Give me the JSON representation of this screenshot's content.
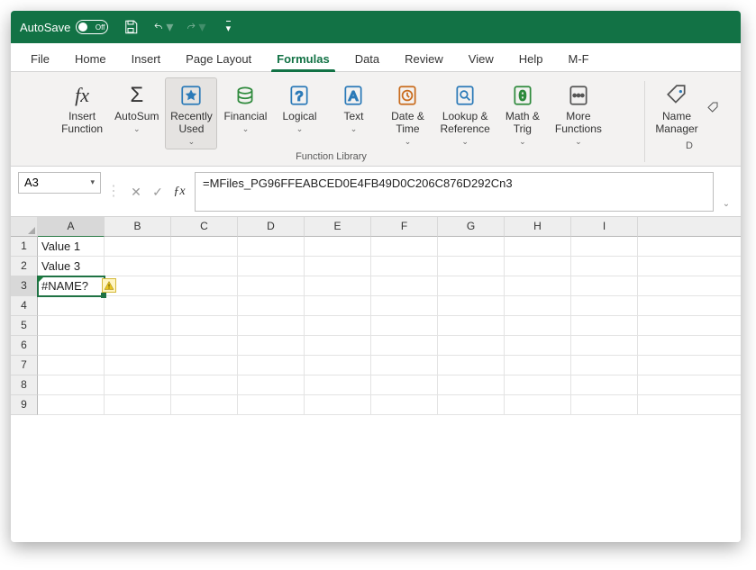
{
  "titlebar": {
    "autosave_label": "AutoSave",
    "autosave_state": "Off"
  },
  "tabs": {
    "items": [
      {
        "label": "File"
      },
      {
        "label": "Home"
      },
      {
        "label": "Insert"
      },
      {
        "label": "Page Layout"
      },
      {
        "label": "Formulas",
        "active": true
      },
      {
        "label": "Data"
      },
      {
        "label": "Review"
      },
      {
        "label": "View"
      },
      {
        "label": "Help"
      },
      {
        "label": "M-F"
      }
    ]
  },
  "ribbon": {
    "function_library_label": "Function Library",
    "defined_names_label": "D",
    "buttons": {
      "insert_function": "Insert\nFunction",
      "autosum": "AutoSum",
      "recently_used": "Recently\nUsed",
      "financial": "Financial",
      "logical": "Logical",
      "text": "Text",
      "date_time": "Date &\nTime",
      "lookup_ref": "Lookup &\nReference",
      "math_trig": "Math &\nTrig",
      "more_functions": "More\nFunctions",
      "name_manager": "Name\nManager"
    }
  },
  "formula_bar": {
    "name_box": "A3",
    "formula": "=MFiles_PG96FFEABCED0E4FB49D0C206C876D292Cn3"
  },
  "sheet": {
    "columns": [
      "A",
      "B",
      "C",
      "D",
      "E",
      "F",
      "G",
      "H",
      "I"
    ],
    "row_count": 9,
    "selected_cell": "A3",
    "rows": [
      {
        "A": "Value 1"
      },
      {
        "A": "Value 3"
      },
      {
        "A": "#NAME?",
        "error": true
      }
    ]
  }
}
